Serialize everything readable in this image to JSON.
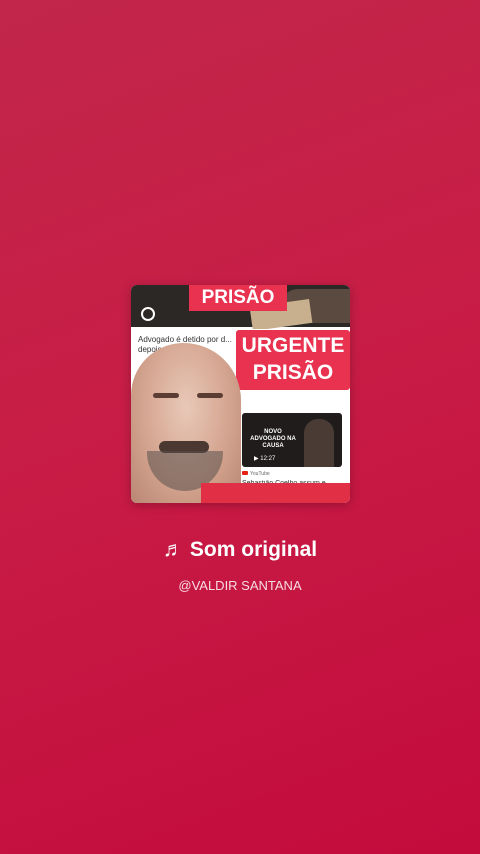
{
  "cover": {
    "banner_top": "PRISÃO",
    "headline": "Advogado é detido por d... depois... ...ulto e...",
    "badge_line1": "URGENTE",
    "badge_line2": "PRISÃO",
    "thumb_text": "NOVO ADVOGADO NA CAUSA",
    "thumb_time": "▶ 12:27",
    "source": "YouTube",
    "caption": "Sebastião Coelho assum e..."
  },
  "audio": {
    "icon": "music-note-icon",
    "note_glyph": "♬",
    "title": "Som original",
    "author": "@VALDIR SANTANA"
  },
  "colors": {
    "background_top": "#c2264a",
    "background_bottom": "#c30b3c",
    "badge_red": "#e8324f",
    "text": "#ffffff"
  }
}
